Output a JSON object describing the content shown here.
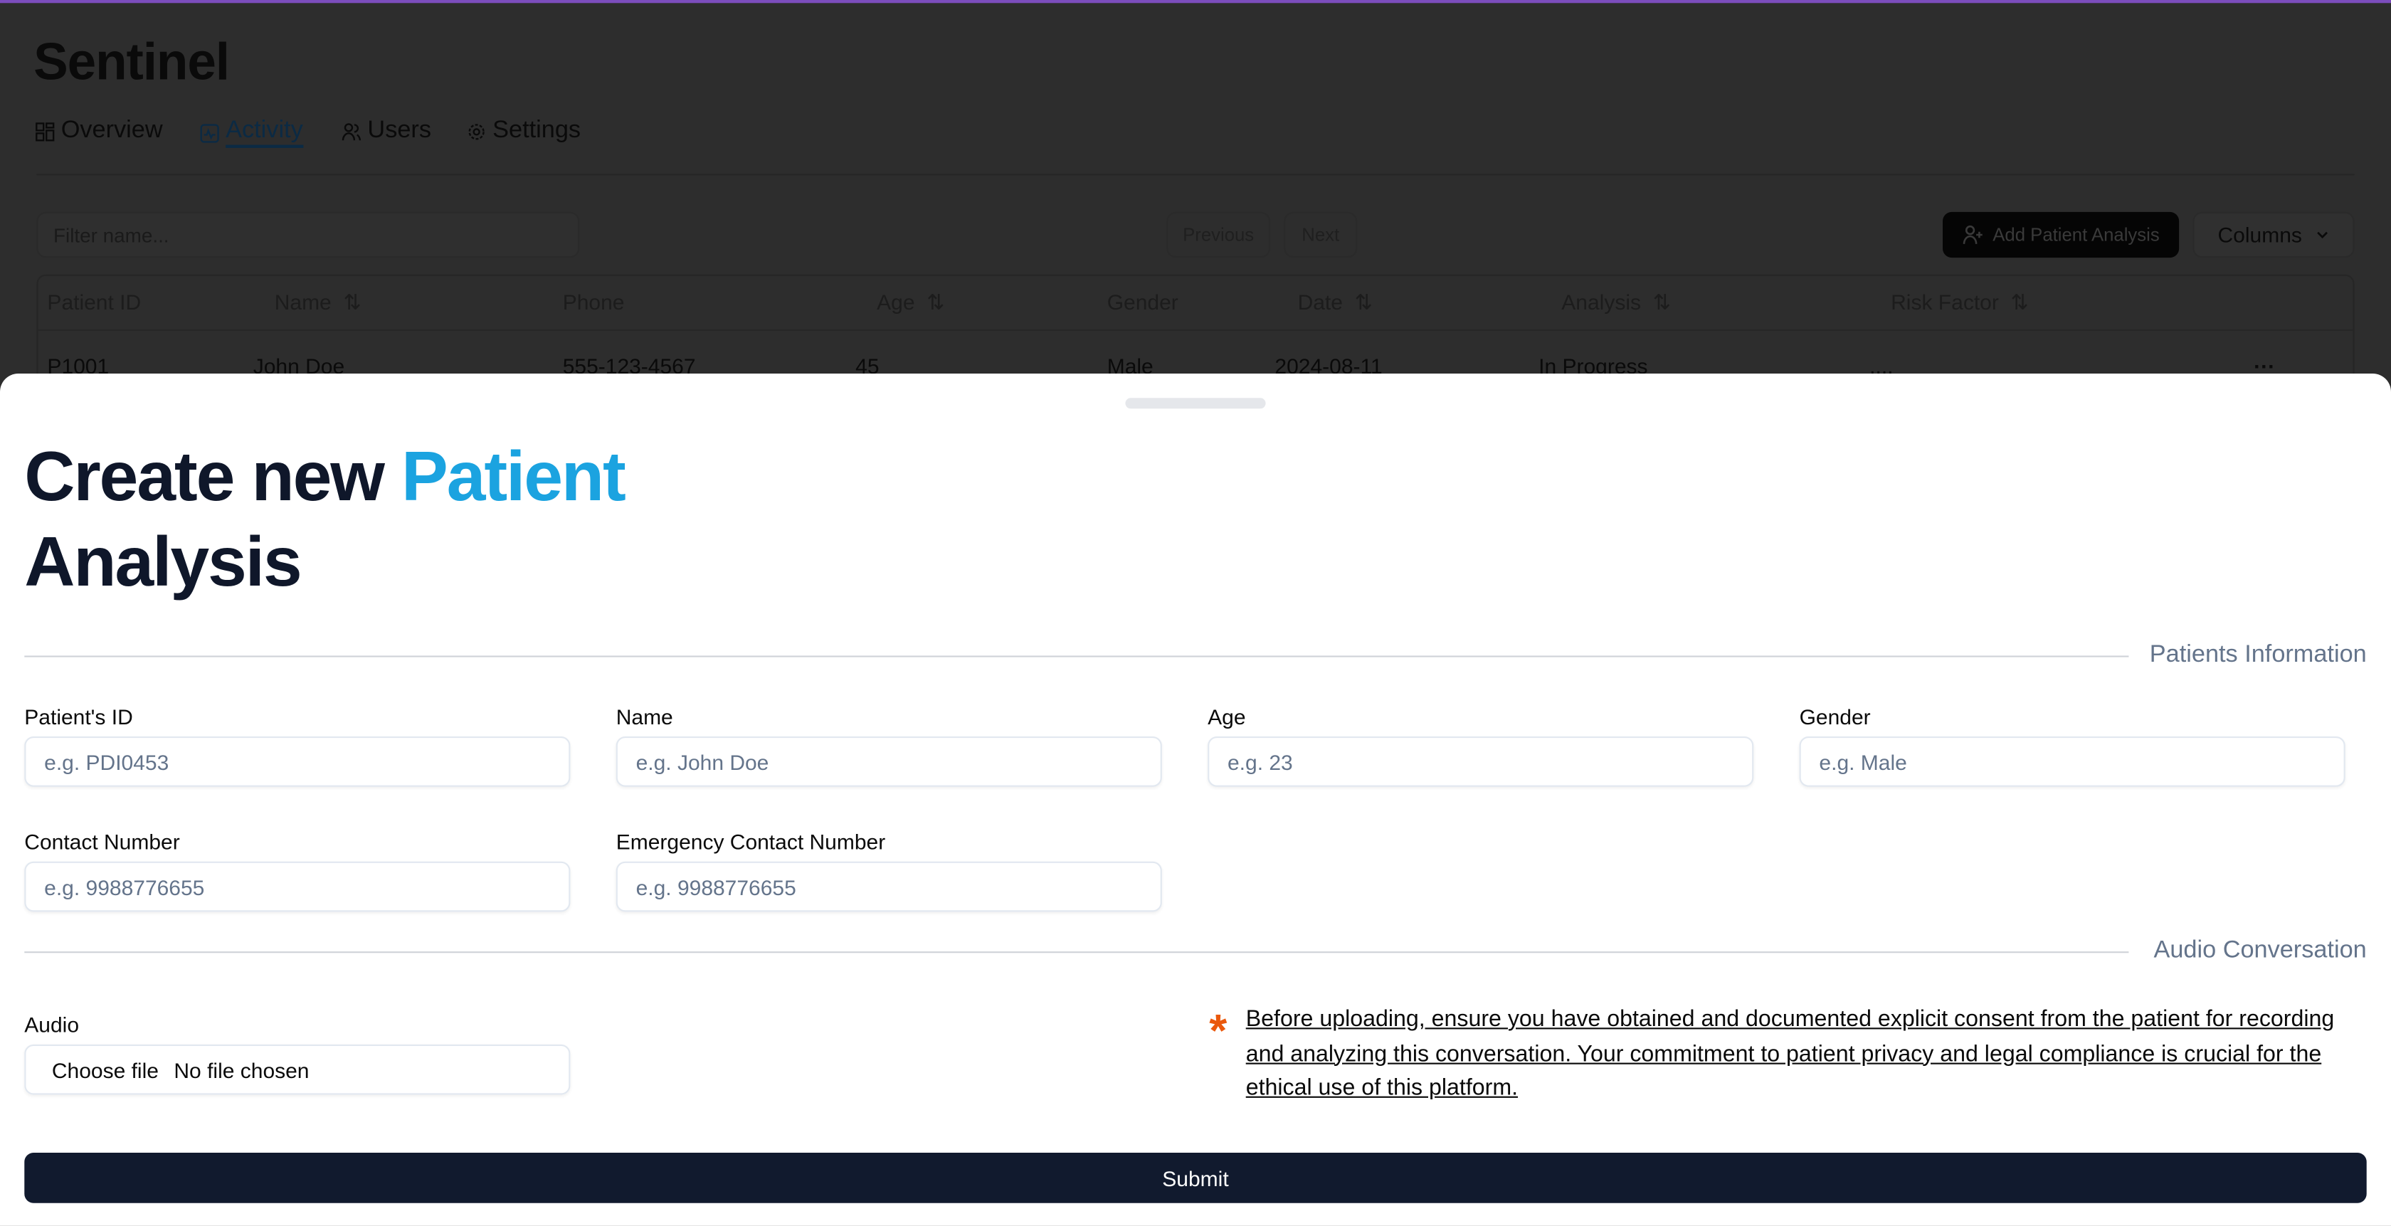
{
  "app": {
    "title": "Sentinel"
  },
  "nav": {
    "tabs": [
      {
        "label": "Overview",
        "icon": "grid-icon"
      },
      {
        "label": "Activity",
        "icon": "activity-icon",
        "active": true
      },
      {
        "label": "Users",
        "icon": "users-icon"
      },
      {
        "label": "Settings",
        "icon": "gear-icon"
      }
    ]
  },
  "toolbar": {
    "filter_placeholder": "Filter name...",
    "previous": "Previous",
    "next": "Next",
    "add": "Add Patient Analysis",
    "columns": "Columns"
  },
  "table": {
    "headers": [
      "Patient ID",
      "Name",
      "Phone",
      "Age",
      "Gender",
      "Date",
      "Analysis",
      "Risk Factor"
    ],
    "rows": [
      {
        "id": "P1001",
        "name": "John Doe",
        "phone": "555-123-4567",
        "age": "45",
        "gender": "Male",
        "date": "2024-08-11",
        "analysis": "In Progress",
        "risk": "....",
        "actions": "···"
      }
    ]
  },
  "sheet": {
    "title_part1": "Create new ",
    "title_accent": "Patient",
    "title_part2": "Analysis",
    "section1": "Patients Information",
    "section2": "Audio Conversation",
    "fields": {
      "patient_id": {
        "label": "Patient's ID",
        "placeholder": "e.g. PDI0453"
      },
      "name": {
        "label": "Name",
        "placeholder": "e.g. John Doe"
      },
      "age": {
        "label": "Age",
        "placeholder": "e.g. 23"
      },
      "gender": {
        "label": "Gender",
        "placeholder": "e.g. Male"
      },
      "contact": {
        "label": "Contact Number",
        "placeholder": "e.g. 9988776655"
      },
      "emergency": {
        "label": "Emergency Contact Number",
        "placeholder": "e.g. 9988776655"
      },
      "audio": {
        "label": "Audio",
        "button": "Choose file",
        "status": "No file chosen"
      }
    },
    "consent_note": "Before uploading, ensure you have obtained and documented explicit consent from the patient for recording and analyzing this conversation. Your commitment to patient privacy and legal compliance is crucial for the ethical use of this platform.",
    "asterisk": "*",
    "submit": "Submit"
  },
  "colors": {
    "accent": "#1ba3e0",
    "warning": "#ea580c",
    "primary": "#111a2e",
    "top_bar": "#7c4dbd"
  }
}
